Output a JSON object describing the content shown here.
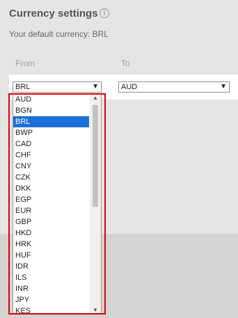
{
  "header": {
    "title": "Currency settings",
    "info_icon": "info-icon",
    "default_currency_text": "Your default currency: BRL"
  },
  "form": {
    "from_label": "From",
    "to_label": "To",
    "from_value": "BRL",
    "to_value": "AUD"
  },
  "dropdown": {
    "selected": "BRL",
    "options": [
      "AUD",
      "BGN",
      "BRL",
      "BWP",
      "CAD",
      "CHF",
      "CNY",
      "CZK",
      "DKK",
      "EGP",
      "EUR",
      "GBP",
      "HKD",
      "HRK",
      "HUF",
      "IDR",
      "ILS",
      "INR",
      "JPY",
      "KES"
    ]
  },
  "colors": {
    "selected_option_bg": "#1a6fd6",
    "highlight_border": "#e00000"
  }
}
